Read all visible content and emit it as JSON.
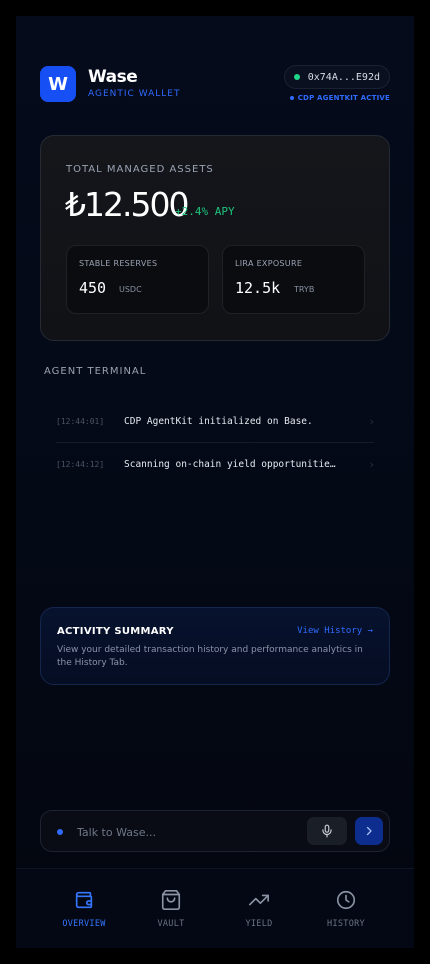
{
  "header": {
    "logo_letter": "W",
    "brand_name": "Wase",
    "brand_subtitle": "AGENTIC WALLET",
    "wallet_address": "0x74A...E92d",
    "cdp_status": "CDP AGENTKIT ACTIVE"
  },
  "assets": {
    "label": "TOTAL MANAGED ASSETS",
    "value": "₺12.500",
    "apy": "+2.4% APY",
    "stable": {
      "label": "STABLE RESERVES",
      "value": "450",
      "unit": "USDC"
    },
    "lira": {
      "label": "LIRA EXPOSURE",
      "value": "12.5k",
      "unit": "TRYB"
    }
  },
  "terminal": {
    "title": "AGENT TERMINAL",
    "logs": [
      {
        "time": "[12:44:01]",
        "message": "CDP AgentKit initialized on Base."
      },
      {
        "time": "[12:44:12]",
        "message": "Scanning on-chain yield opportunities..."
      }
    ]
  },
  "activity": {
    "title": "ACTIVITY SUMMARY",
    "link": "View History →",
    "description": "View your detailed transaction history and performance analytics in the History Tab."
  },
  "input": {
    "placeholder": "Talk to Wase..."
  },
  "nav": {
    "items": [
      {
        "label": "OVERVIEW",
        "icon": "wallet-icon",
        "active": true
      },
      {
        "label": "VAULT",
        "icon": "shopping-bag-icon",
        "active": false
      },
      {
        "label": "YIELD",
        "icon": "trending-up-icon",
        "active": false
      },
      {
        "label": "HISTORY",
        "icon": "clock-icon",
        "active": false
      }
    ]
  },
  "colors": {
    "accent": "#2f6bff",
    "success": "#1fc47d",
    "status_online": "#1fd68a",
    "background": "#050b1b"
  }
}
